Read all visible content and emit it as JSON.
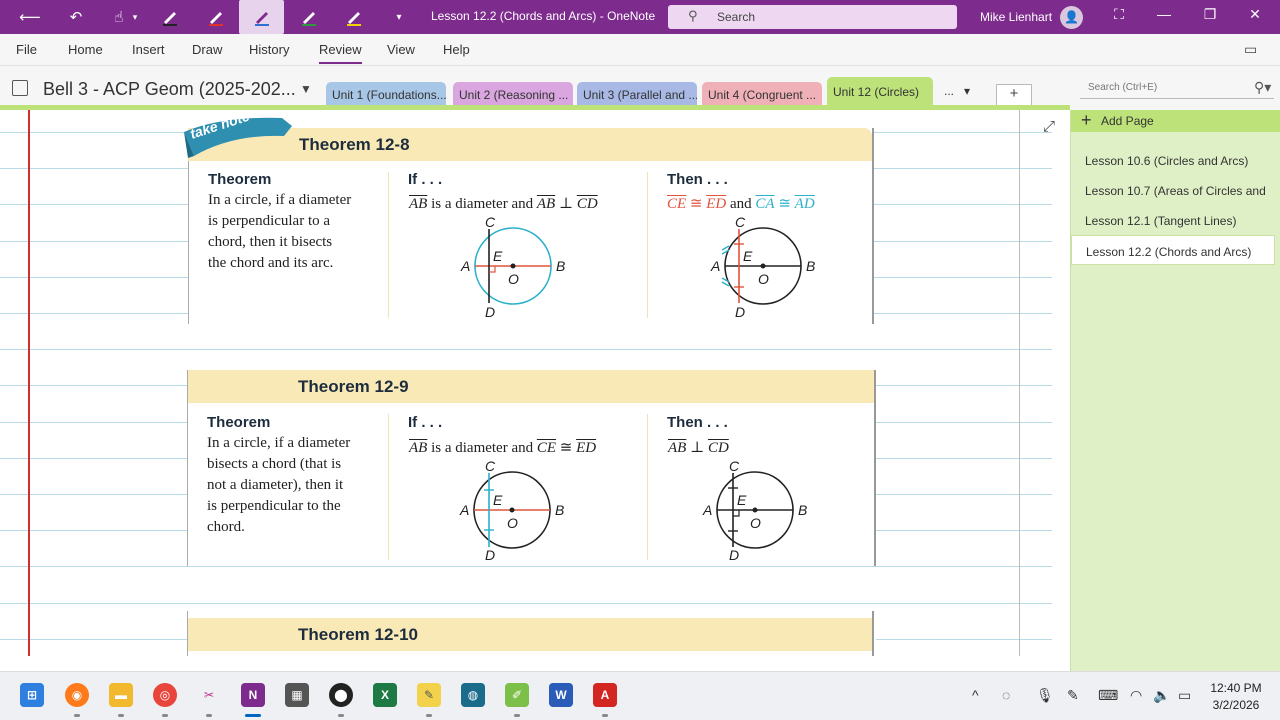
{
  "titlebar": {
    "doc_title": "Lesson 12.2 (Chords and Arcs)  -  OneNote",
    "search_placeholder": "Search",
    "user_name": "Mike Lienhart",
    "pen_colors": [
      "#222222",
      "#e0312d",
      "#2f6fd1",
      "#2e9a3d",
      "#f0d400"
    ]
  },
  "ribbon": {
    "tabs": [
      "File",
      "Home",
      "Insert",
      "Draw",
      "History",
      "Review",
      "View",
      "Help"
    ],
    "active_tab": "Review"
  },
  "notebook": {
    "name": "Bell 3 - ACP Geom (2025-202...",
    "sections": [
      {
        "label": "Unit 1 (Foundations...",
        "color": "#a8c6e6"
      },
      {
        "label": "Unit 2 (Reasoning ...",
        "color": "#d9a6e0"
      },
      {
        "label": "Unit 3 (Parallel and ...",
        "color": "#a8b9e6"
      },
      {
        "label": "Unit 4 (Congruent ...",
        "color": "#efb1b7"
      },
      {
        "label": "Unit 12 (Circles)",
        "color": "#bde27a"
      }
    ],
    "more_label": "...",
    "page_search_placeholder": "Search (Ctrl+E)"
  },
  "pages_pane": {
    "add_label": "Add Page",
    "pages": [
      "Lesson 10.6 (Circles and Arcs)",
      "Lesson 10.7 (Areas of Circles and",
      "Lesson 12.1 (Tangent Lines)",
      "Lesson 12.2 (Chords and Arcs)"
    ],
    "active_index": 3
  },
  "content": {
    "take_note": "take note",
    "col_labels": {
      "theorem": "Theorem",
      "if": "If . . .",
      "then": "Then . . ."
    },
    "theorem_12_8": {
      "title": "Theorem 12-8",
      "statement_lines": [
        "In a circle, if a diameter",
        "is perpendicular to a",
        "chord, then it bisects",
        "the chord and its arc."
      ],
      "if": {
        "seg1": "AB",
        "mid": "is a diameter and",
        "seg2": "AB",
        "perp": "⊥",
        "seg3": "CD"
      },
      "then": {
        "seg1": "CE",
        "cong": "≅",
        "seg2": "ED",
        "and": "and",
        "arc1": "CA",
        "arc2": "AD"
      }
    },
    "theorem_12_9": {
      "title": "Theorem 12-9",
      "statement_lines": [
        "In a circle, if a diameter",
        "bisects a chord (that is",
        "not a diameter), then it",
        "is perpendicular to the",
        "chord."
      ],
      "if": {
        "seg1": "AB",
        "mid": "is a diameter and",
        "seg2": "CE",
        "cong": "≅",
        "seg3": "ED"
      },
      "then": {
        "seg1": "AB",
        "perp": "⊥",
        "seg2": "CD"
      }
    },
    "theorem_12_10": {
      "title": "Theorem 12-10"
    },
    "point_labels": {
      "a": "A",
      "b": "B",
      "c": "C",
      "d": "D",
      "e": "E",
      "o": "O"
    }
  },
  "taskbar": {
    "apps": [
      "start",
      "firefox",
      "file-explorer",
      "chrome",
      "snipping-tool",
      "onenote",
      "calculator",
      "davinci",
      "excel",
      "pencil-app",
      "webex",
      "green-app",
      "word",
      "acrobat"
    ],
    "active_app": "onenote",
    "time": "12:40 PM",
    "date": "3/2/2026"
  }
}
